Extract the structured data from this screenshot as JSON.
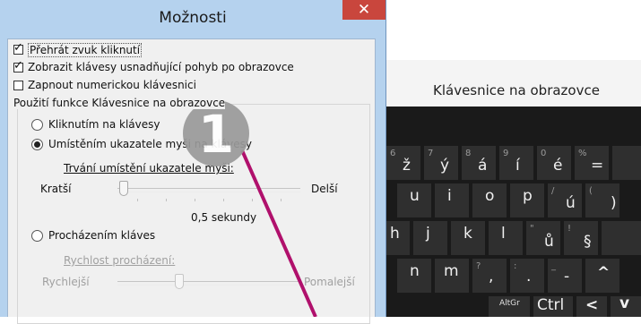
{
  "dialog": {
    "title": "Možnosti",
    "close_label": "✕",
    "checkboxes": [
      {
        "label": "Přehrát zvuk kliknutí",
        "checked": true
      },
      {
        "label": "Zobrazit klávesy usnadňující pohyb po obrazovce",
        "checked": true
      },
      {
        "label": "Zapnout numerickou klávesnici",
        "checked": false
      }
    ],
    "group_label": "Použití funkce Klávesnice na obrazovce",
    "radios": [
      {
        "label": "Kliknutím na klávesy",
        "checked": false
      },
      {
        "label": "Umístěním ukazatele myši na klávesy",
        "checked": true
      },
      {
        "label": "Procházením kláves",
        "checked": false
      }
    ],
    "hover_slider": {
      "label": "Trvání umístění ukazatele myši:",
      "min_label": "Kratší",
      "max_label": "Delší",
      "value_text": "0,5 sekundy",
      "level": 0.03
    },
    "scan_slider": {
      "label": "Rychlost procházení:",
      "min_label": "Rychlejší",
      "max_label": "Pomalejší",
      "level": 0.35,
      "disabled": true
    }
  },
  "osk": {
    "title": "Klávesnice na obrazovce",
    "rows": [
      [
        {
          "main": "ž",
          "sub": "6"
        },
        {
          "main": "ý",
          "sub": "7"
        },
        {
          "main": "á",
          "sub": "8"
        },
        {
          "main": "í",
          "sub": "9"
        },
        {
          "main": "é",
          "sub": "0"
        },
        {
          "main": "=",
          "sub": "%"
        }
      ],
      [
        {
          "main": "u",
          "sub": ""
        },
        {
          "main": "i",
          "sub": ""
        },
        {
          "main": "o",
          "sub": ""
        },
        {
          "main": "p",
          "sub": ""
        },
        {
          "main": "ú",
          "sub": "/"
        },
        {
          "main": ")",
          "sub": "("
        }
      ],
      [
        {
          "main": "h",
          "sub": ""
        },
        {
          "main": "j",
          "sub": ""
        },
        {
          "main": "k",
          "sub": ""
        },
        {
          "main": "l",
          "sub": ""
        },
        {
          "main": "ů",
          "sub": "\""
        },
        {
          "main": "§",
          "sub": "!"
        }
      ],
      [
        {
          "main": "n",
          "sub": ""
        },
        {
          "main": "m",
          "sub": ""
        },
        {
          "main": ",",
          "sub": "?"
        },
        {
          "main": ".",
          "sub": ":"
        },
        {
          "main": "-",
          "sub": "_"
        },
        {
          "main": "^",
          "sub": ""
        }
      ],
      [
        {
          "main": "AltGr",
          "sub": ""
        },
        {
          "main": "Ctrl",
          "sub": ""
        },
        {
          "main": "<",
          "sub": ""
        },
        {
          "main": "v",
          "sub": ""
        }
      ]
    ]
  },
  "annotation": {
    "number": "1",
    "color": "#b0106c"
  }
}
